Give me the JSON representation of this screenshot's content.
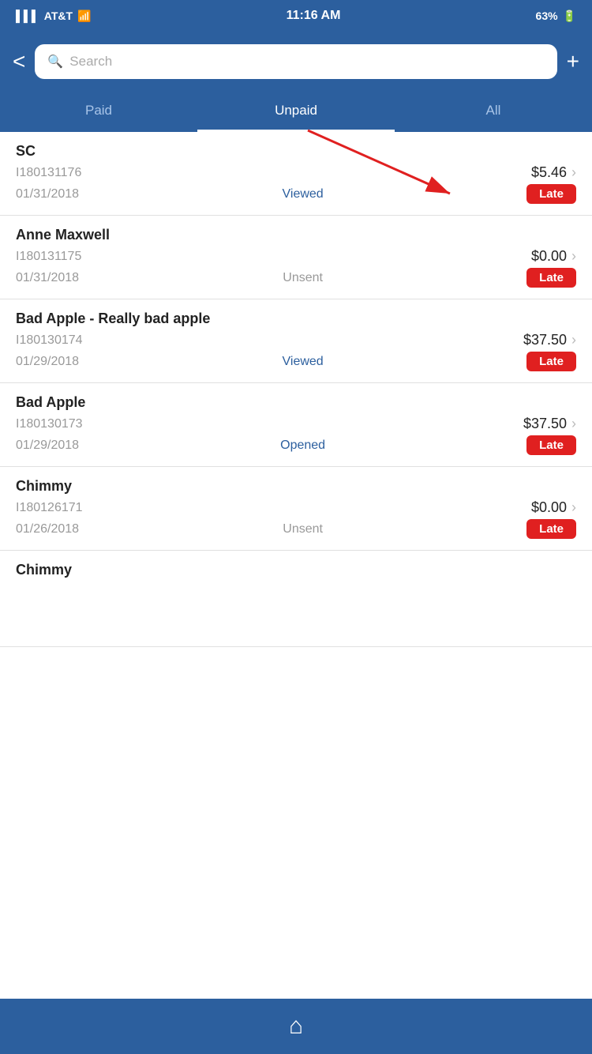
{
  "statusBar": {
    "carrier": "AT&T",
    "time": "11:16 AM",
    "battery": "63%"
  },
  "header": {
    "backLabel": "<",
    "searchPlaceholder": "Search",
    "addLabel": "+"
  },
  "tabs": [
    {
      "id": "paid",
      "label": "Paid",
      "active": false
    },
    {
      "id": "unpaid",
      "label": "Unpaid",
      "active": true
    },
    {
      "id": "all",
      "label": "All",
      "active": false
    }
  ],
  "invoices": [
    {
      "name": "SC",
      "id": "I180131176",
      "amount": "$5.46",
      "date": "01/31/2018",
      "statusType": "viewed",
      "statusLabel": "Viewed",
      "badge": "Late"
    },
    {
      "name": "Anne Maxwell",
      "id": "I180131175",
      "amount": "$0.00",
      "date": "01/31/2018",
      "statusType": "unsent",
      "statusLabel": "Unsent",
      "badge": "Late"
    },
    {
      "name": "Bad Apple - Really bad apple",
      "id": "I180130174",
      "amount": "$37.50",
      "date": "01/29/2018",
      "statusType": "viewed",
      "statusLabel": "Viewed",
      "badge": "Late"
    },
    {
      "name": "Bad Apple",
      "id": "I180130173",
      "amount": "$37.50",
      "date": "01/29/2018",
      "statusType": "opened",
      "statusLabel": "Opened",
      "badge": "Late"
    },
    {
      "name": "Chimmy",
      "id": "I180126171",
      "amount": "$0.00",
      "date": "01/26/2018",
      "statusType": "unsent",
      "statusLabel": "Unsent",
      "badge": "Late"
    },
    {
      "name": "Chimmy",
      "id": "",
      "amount": "",
      "date": "",
      "statusType": "",
      "statusLabel": "",
      "badge": ""
    }
  ],
  "bottomBar": {
    "homeIcon": "⌂"
  }
}
